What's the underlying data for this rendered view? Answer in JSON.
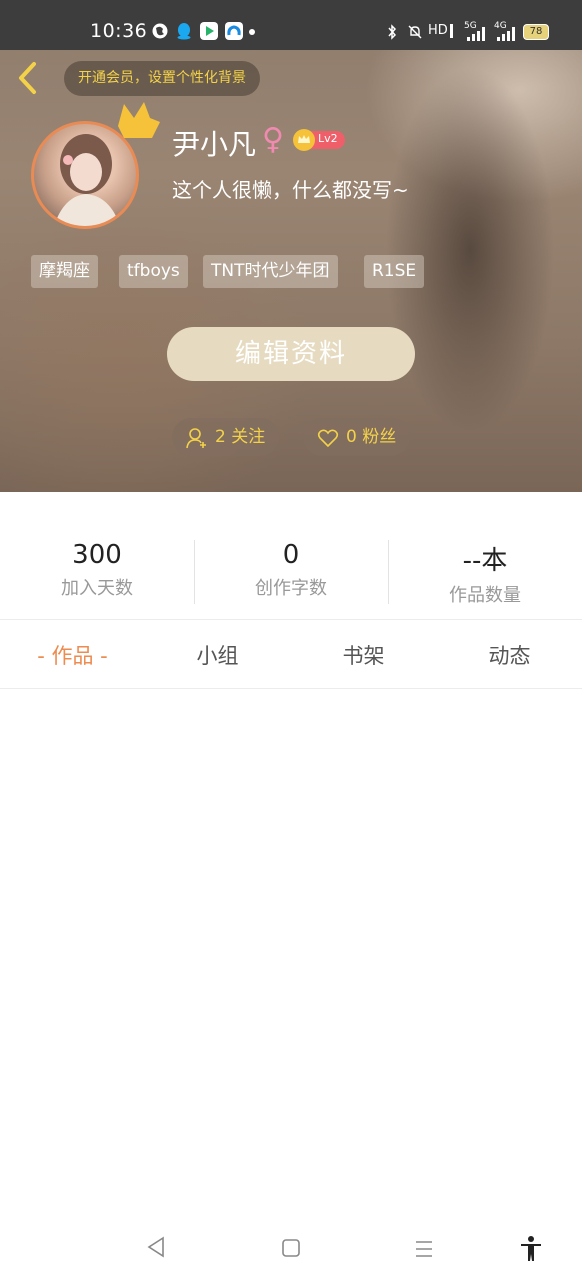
{
  "status_bar": {
    "time": "10:36",
    "right_text": "HD",
    "net1": "5G",
    "net2": "4G",
    "battery": "78"
  },
  "header": {
    "vip_banner": "开通会员，设置个性化背景",
    "username": "尹小凡",
    "gender_symbol": "♀",
    "level": "Lv2",
    "bio": "这个人很懒，什么都没写~",
    "tags": [
      "摩羯座",
      "tfboys",
      "TNT时代少年团",
      "R1SE"
    ],
    "edit_button": "编辑资料",
    "following": "2 关注",
    "followers": "0 粉丝"
  },
  "stats": [
    {
      "value": "300",
      "label": "加入天数"
    },
    {
      "value": "0",
      "label": "创作字数"
    },
    {
      "value": "--本",
      "label": "作品数量"
    }
  ],
  "tabs": [
    {
      "label": "- 作品 -",
      "active": true
    },
    {
      "label": "小组",
      "active": false
    },
    {
      "label": "书架",
      "active": false
    },
    {
      "label": "动态",
      "active": false
    }
  ],
  "colors": {
    "accent": "#ee8b4f",
    "gold": "#f3d24a",
    "edit_button_bg": "#e6dbc0"
  }
}
